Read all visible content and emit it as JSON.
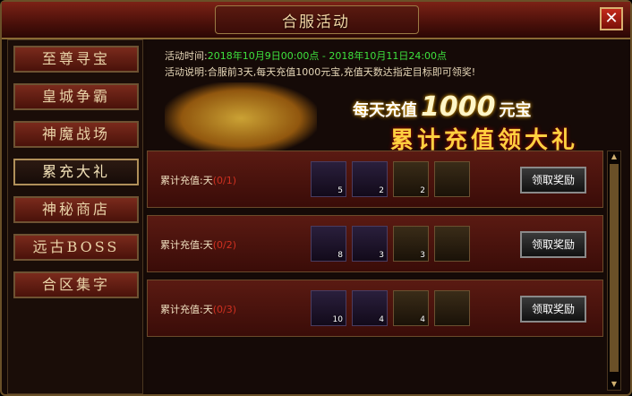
{
  "title": "合服活动",
  "close_label": "✕",
  "sidebar": {
    "items": [
      {
        "label": "至尊寻宝",
        "active": false
      },
      {
        "label": "皇城争霸",
        "active": false
      },
      {
        "label": "神魔战场",
        "active": false
      },
      {
        "label": "累充大礼",
        "active": true
      },
      {
        "label": "神秘商店",
        "active": false
      },
      {
        "label": "远古BOSS",
        "active": false
      },
      {
        "label": "合区集字",
        "active": false
      }
    ]
  },
  "info": {
    "time_label": "活动时间:",
    "time_value": "2018年10月9日00:00点 - 2018年10月11日24:00点",
    "desc": "活动说明:合服前3天,每天充值1000元宝,充值天数达指定目标即可领奖!"
  },
  "banner": {
    "line1_pre": "每天充值",
    "line1_amount": "1000",
    "line1_post": "元宝",
    "line2": "累计充值领大礼"
  },
  "rows": [
    {
      "label": "累计充值:天",
      "progress": "(0/1)",
      "rewards": [
        {
          "icon": "gold-ingot-1000-icon",
          "qty": "5"
        },
        {
          "icon": "gold-ticket-icon",
          "qty": "2"
        },
        {
          "icon": "scroll-icon",
          "qty": "2"
        },
        {
          "icon": "golden-orb-icon",
          "qty": ""
        }
      ],
      "button": "领取奖励"
    },
    {
      "label": "累计充值:天",
      "progress": "(0/2)",
      "rewards": [
        {
          "icon": "gold-ingot-1000-icon",
          "qty": "8"
        },
        {
          "icon": "gold-ticket-icon",
          "qty": "3"
        },
        {
          "icon": "scroll-icon",
          "qty": "3"
        },
        {
          "icon": "golden-orb-icon",
          "qty": ""
        }
      ],
      "button": "领取奖励"
    },
    {
      "label": "累计充值:天",
      "progress": "(0/3)",
      "rewards": [
        {
          "icon": "gold-ingot-1000-icon",
          "qty": "10"
        },
        {
          "icon": "gold-ticket-icon",
          "qty": "4"
        },
        {
          "icon": "scroll-icon",
          "qty": "4"
        },
        {
          "icon": "golden-orb-icon",
          "qty": ""
        }
      ],
      "button": "领取奖励"
    }
  ],
  "colors": {
    "accent_gold": "#ffd040",
    "progress_red": "#d03020",
    "time_green": "#3ee23e"
  }
}
